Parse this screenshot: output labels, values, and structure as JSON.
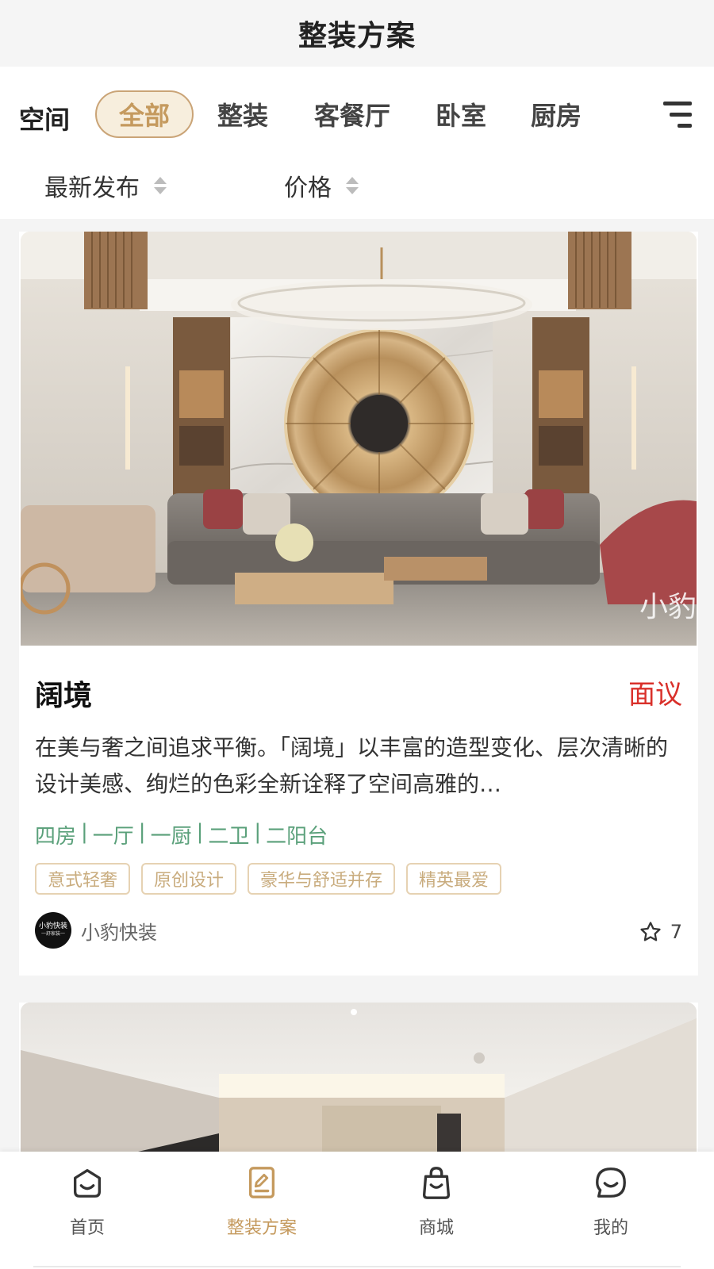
{
  "header": {
    "title": "整装方案"
  },
  "filters": {
    "category_label": "空间",
    "categories": [
      {
        "label": "全部",
        "active": true
      },
      {
        "label": "整装",
        "active": false
      },
      {
        "label": "客餐厅",
        "active": false
      },
      {
        "label": "卧室",
        "active": false
      },
      {
        "label": "厨房",
        "active": false
      }
    ],
    "overflow_icon": "list-filter-icon",
    "sort": [
      {
        "label": "最新发布",
        "icon": "sort-arrows-icon"
      },
      {
        "label": "价格",
        "icon": "sort-arrows-icon"
      }
    ]
  },
  "cards": [
    {
      "title": "阔境",
      "price": "面议",
      "description": "在美与奢之间追求平衡。「阔境」以丰富的造型变化、层次清晰的设计美感、绚烂的色彩全新诠释了空间高雅的…",
      "layout": [
        "四房",
        "一厅",
        "一厨",
        "二卫",
        "二阳台"
      ],
      "layout_separator": "|",
      "tags": [
        "意式轻奢",
        "原创设计",
        "豪华与舒适并存",
        "精英最爱"
      ],
      "author": {
        "name": "小豹快装",
        "avatar_text": "小豹快装",
        "avatar_subtext": "一舒家装一"
      },
      "favorites": {
        "icon": "star-icon",
        "count": "7"
      },
      "image": "luxury-living-room-photo",
      "watermark": "小豹"
    },
    {
      "image": "modern-bedroom-photo"
    }
  ],
  "bottom_nav": [
    {
      "label": "首页",
      "icon": "home-face-icon",
      "active": false
    },
    {
      "label": "整装方案",
      "icon": "plan-document-icon",
      "active": true
    },
    {
      "label": "商城",
      "icon": "shopping-bag-icon",
      "active": false
    },
    {
      "label": "我的",
      "icon": "chat-face-icon",
      "active": false
    }
  ],
  "colors": {
    "accent": "#c59a5e",
    "accent_bg": "#f7eedd",
    "price_red": "#d9302a",
    "layout_green": "#5aa07a",
    "tag_border": "#e6d2b3",
    "page_bg": "#f4f4f4"
  }
}
